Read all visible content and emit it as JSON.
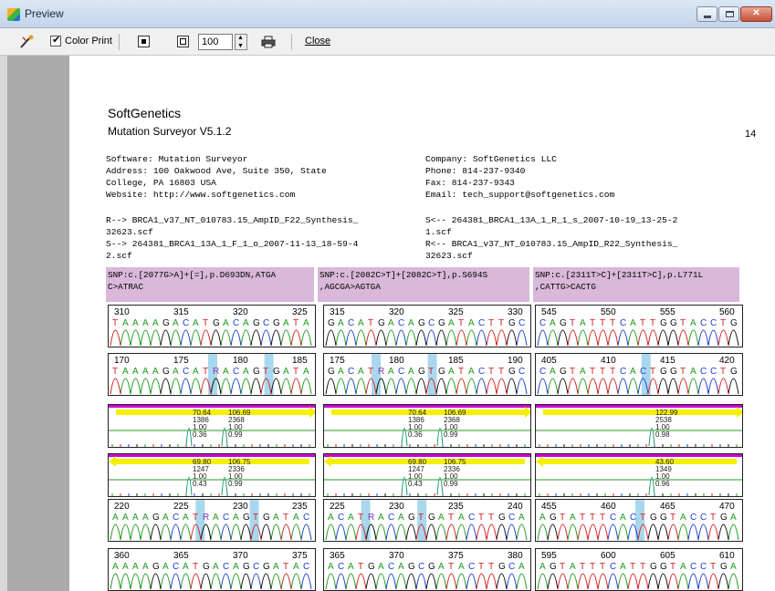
{
  "window": {
    "title": "Preview"
  },
  "toolbar": {
    "color_print_label": "Color Print",
    "color_print_checked": true,
    "zoom_value": "100",
    "close_label": "Close"
  },
  "page": {
    "company_name": "SoftGenetics",
    "product_name": "Mutation Surveyor V5.1.2",
    "page_number": "14",
    "info": {
      "software": "Software: Mutation Surveyor",
      "address1": "Address: 100 Oakwood Ave, Suite 350, State",
      "address2": "College, PA 16803 USA",
      "website": "Website: http://www.softgenetics.com",
      "company": "Company: SoftGenetics LLC",
      "phone": "Phone: 814-237-9340",
      "fax": "Fax: 814-237-9343",
      "email": "Email: tech_support@softgenetics.com"
    },
    "traces": {
      "r_forward_1": "R--> BRCA1_v37_NT_010783.15_AmpID_F22_Synthesis_",
      "r_forward_2": "32623.scf",
      "s_forward_1": "S--> 264381_BRCA1_13A_1_F_1_o_2007-11-13_18-59-4",
      "s_forward_2": "2.scf",
      "s_reverse_1": "S<-- 264381_BRCA1_13A_1_R_1_s_2007-10-19_13-25-2",
      "s_reverse_2": "1.scf",
      "r_reverse_1": "R<-- BRCA1_v37_NT_010783.15_AmpID_R22_Synthesis_",
      "r_reverse_2": "32623.scf"
    },
    "snps": [
      {
        "line1": "SNP:c.[2077G>A]+[=],p.D693DN,ATGA",
        "line2": "C>ATRAC"
      },
      {
        "line1": "SNP:c.[2082C>T]+[2082C>T],p.S694S",
        "line2": ",AGCGA>AGTGA"
      },
      {
        "line1": "SNP:c.[2311T>C]+[2311T>C],p.L771L",
        "line2": ",CATTG>CACTG"
      }
    ]
  },
  "panels": [
    [
      {
        "type": "seq",
        "nums": [
          "310",
          "315",
          "320",
          "325"
        ],
        "seq": "TAAAAGACATGACAGCGATA",
        "highlights": []
      },
      {
        "type": "seq",
        "nums": [
          "315",
          "320",
          "325",
          "330"
        ],
        "seq": "GACATGACAGCGATACTTGC",
        "highlights": []
      },
      {
        "type": "seq",
        "nums": [
          "545",
          "550",
          "555",
          "560"
        ],
        "seq": "CAGTATTTCATTGGTACCTG",
        "highlights": []
      }
    ],
    [
      {
        "type": "seq",
        "nums": [
          "170",
          "175",
          "180",
          "185"
        ],
        "seq": "TAAAAGACATRACAGTGATA",
        "highlights": [
          0.5,
          0.77
        ]
      },
      {
        "type": "seq",
        "nums": [
          "175",
          "180",
          "185",
          "190"
        ],
        "seq": "GACATRACAGTGATACTTGC",
        "highlights": [
          0.25,
          0.52
        ]
      },
      {
        "type": "seq",
        "nums": [
          "405",
          "410",
          "415",
          "420"
        ],
        "seq": "CAGTATTTCACTGGTACCTG",
        "highlights": [
          0.53
        ]
      }
    ],
    [
      {
        "type": "mut",
        "labels": [
          "70.64",
          "1386",
          "1.00",
          "0.36"
        ],
        "labels2": [
          "106.69",
          "2368",
          "1.00",
          "0.99"
        ],
        "arrow": "right"
      },
      {
        "type": "mut",
        "labels": [
          "70.64",
          "1386",
          "1.00",
          "0.36"
        ],
        "labels2": [
          "106.69",
          "2368",
          "1.00",
          "0.99"
        ],
        "arrow": "right"
      },
      {
        "type": "mut",
        "labels": [],
        "labels2": [
          "122.99",
          "2538",
          "1.00",
          "0.98"
        ],
        "arrow": "right"
      }
    ],
    [
      {
        "type": "mut",
        "labels": [
          "69.80",
          "1247",
          "1.00",
          "0.43"
        ],
        "labels2": [
          "106.75",
          "2336",
          "1.00",
          "0.99"
        ],
        "arrow": "left"
      },
      {
        "type": "mut",
        "labels": [
          "69.80",
          "1247",
          "1.00",
          "0.43"
        ],
        "labels2": [
          "106.75",
          "2336",
          "1.00",
          "0.99"
        ],
        "arrow": "left"
      },
      {
        "type": "mut",
        "labels": [],
        "labels2": [
          "43.60",
          "1349",
          "1.00",
          "0.96"
        ],
        "arrow": "left"
      }
    ],
    [
      {
        "type": "seq",
        "nums": [
          "220",
          "225",
          "230",
          "235"
        ],
        "seq": "AAAAGACATRACAGTGATAC",
        "highlights": [
          0.44,
          0.7
        ]
      },
      {
        "type": "seq",
        "nums": [
          "225",
          "230",
          "235",
          "240"
        ],
        "seq": "ACATRACAGTGATACTTGCA",
        "highlights": [
          0.2,
          0.47
        ]
      },
      {
        "type": "seq",
        "nums": [
          "455",
          "460",
          "465",
          "470"
        ],
        "seq": "AGTATTTCACTGGTACCTGA",
        "highlights": [
          0.5
        ]
      }
    ],
    [
      {
        "type": "seq",
        "nums": [
          "360",
          "365",
          "370",
          "375"
        ],
        "seq": "AAAAGACATGACAGCGATAC",
        "highlights": []
      },
      {
        "type": "seq",
        "nums": [
          "365",
          "370",
          "375",
          "380"
        ],
        "seq": "ACATGACAGCGATACTTGCA",
        "highlights": []
      },
      {
        "type": "seq",
        "nums": [
          "595",
          "600",
          "605",
          "610"
        ],
        "seq": "AGTATTTCATTGGTACCTGA",
        "highlights": []
      }
    ]
  ],
  "colors": {
    "A": "#1f9a1f",
    "C": "#1a3fd0",
    "G": "#111111",
    "T": "#d42020",
    "snp_bg": "#d9b8d9",
    "highlight": "#a9d8ee"
  }
}
